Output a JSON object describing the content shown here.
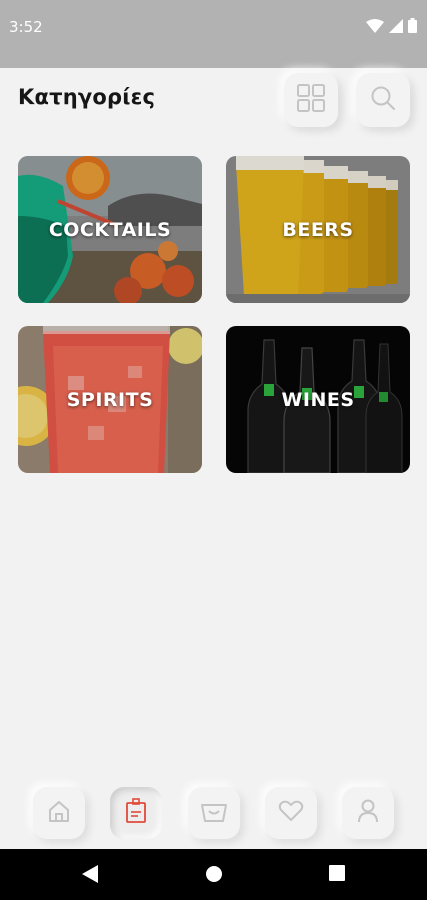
{
  "status_bar": {
    "time": "3:52",
    "icons": [
      "wifi-icon",
      "signal-icon",
      "battery-icon"
    ]
  },
  "header": {
    "title": "Κατηγορίες",
    "grid_button_icon": "grid-icon",
    "search_button_icon": "search-icon"
  },
  "categories": [
    {
      "label": "COCKTAILS",
      "image": "cocktail-photo"
    },
    {
      "label": "BEERS",
      "image": "beer-glasses-photo"
    },
    {
      "label": "SPIRITS",
      "image": "spirit-drink-photo"
    },
    {
      "label": "WINES",
      "image": "wine-bottles-photo"
    }
  ],
  "bottom_nav": {
    "items": [
      {
        "icon": "home-icon",
        "active": false
      },
      {
        "icon": "categories-icon",
        "active": true
      },
      {
        "icon": "shopping-bag-icon",
        "active": false
      },
      {
        "icon": "heart-icon",
        "active": false
      },
      {
        "icon": "user-icon",
        "active": false
      }
    ]
  },
  "system_nav": {
    "icons": [
      "back-icon",
      "home-circle-icon",
      "recents-icon"
    ]
  },
  "colors": {
    "background": "#f2f2f2",
    "status_bar": "#b2b2b2",
    "accent": "#e04a3a",
    "nav_icon": "#bdbdbd"
  }
}
